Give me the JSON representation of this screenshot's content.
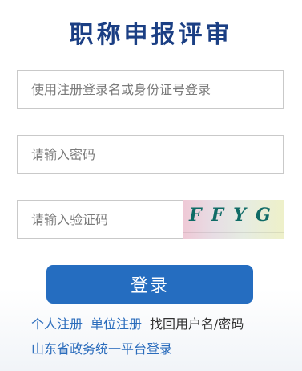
{
  "title": "职称申报评审",
  "form": {
    "username_placeholder": "使用注册登录名或身份证号登录",
    "password_placeholder": "请输入密码",
    "captcha_placeholder": "请输入验证码",
    "captcha_text": "FFYG"
  },
  "login_button": "登录",
  "links": {
    "personal_register": "个人注册",
    "unit_register": "单位注册",
    "recover": "找回用户名/密码",
    "gov_platform": "山东省政务统一平台登录"
  },
  "colors": {
    "title": "#1b3f84",
    "button": "#256dc0",
    "link": "#2a6cbc"
  }
}
